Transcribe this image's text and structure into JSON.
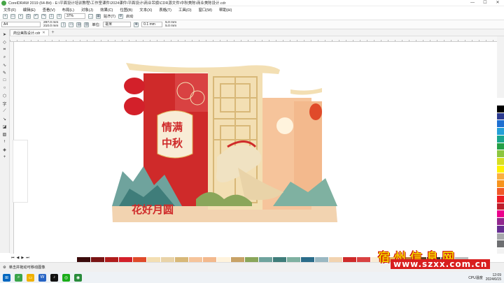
{
  "window": {
    "title": "CorelDRAW 2019 (64-Bit) - E:\\平面设计培训教程\\工作室课件\\2024课件\\平面设计\\商业吊旗\\CDR源文件\\中秋美陈\\商业美陈设计.cdr",
    "minimize": "—",
    "maximize": "☐",
    "close": "✕"
  },
  "menu": [
    "文件(F)",
    "编辑(E)",
    "查看(V)",
    "布局(L)",
    "对象(J)",
    "效果(C)",
    "位图(B)",
    "文本(X)",
    "表格(T)",
    "工具(O)",
    "窗口(W)",
    "帮助(H)"
  ],
  "toolbar": {
    "zoom": "37%",
    "snap_label": "贴齐(T)",
    "launch_label": "启动"
  },
  "property_bar": {
    "paper": "A4",
    "width": "297.0 mm",
    "height": "210.0 mm",
    "unit_label": "单位:",
    "unit": "毫米",
    "nudge": "0.1 mm",
    "dup_x": "5.0 mm",
    "dup_y": "5.0 mm"
  },
  "doc_tab": {
    "label": "商业美陈设计.cdr",
    "close": "✕",
    "add": "+"
  },
  "artwork": {
    "panel_title": "情满中秋",
    "ground_text": "花好月圆"
  },
  "status": {
    "hint": "单击并拖动可移动图像"
  },
  "taskbar": {
    "cpu": "CPU温度",
    "time": "12:09",
    "date": "2024/6/15"
  },
  "watermark": {
    "title": "宿州信息网",
    "url": "www.szxx.com.cn"
  },
  "colors": {
    "red_panel": "#cf2a2a",
    "cream": "#f3dfb3",
    "peach": "#f6c49b",
    "teal": "#6fa39d",
    "gold": "#d8b878"
  },
  "icons": [
    "coreldraw-logo-icon",
    "new-doc-icon",
    "open-icon",
    "save-icon",
    "print-icon",
    "undo-icon",
    "redo-icon",
    "import-icon",
    "export-icon",
    "options-icon",
    "pick-tool-icon",
    "shape-tool-icon",
    "crop-tool-icon",
    "zoom-tool-icon",
    "freehand-tool-icon",
    "rectangle-tool-icon",
    "ellipse-tool-icon",
    "polygon-tool-icon",
    "text-tool-icon",
    "fill-tool-icon",
    "eyedropper-tool-icon",
    "search-icon"
  ]
}
